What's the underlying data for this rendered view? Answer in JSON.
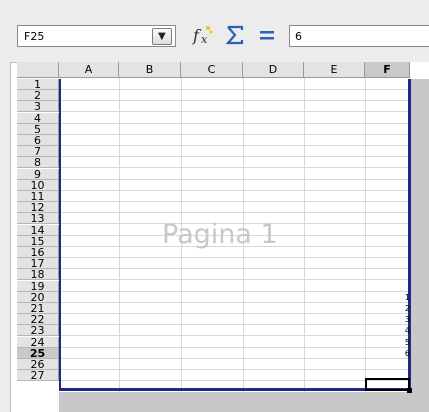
{
  "formula_bar": {
    "cell_reference": "F25",
    "cell_content": "6",
    "function_wizard_icon": "fx-icon",
    "sum_icon": "sum-icon",
    "formula_icon": "equals-icon"
  },
  "columns": [
    "A",
    "B",
    "C",
    "D",
    "E",
    "F"
  ],
  "active_column": "F",
  "rows": [
    "1",
    "2",
    "3",
    "4",
    "5",
    "6",
    "7",
    "8",
    "9",
    "10",
    "11",
    "12",
    "13",
    "14",
    "15",
    "16",
    "17",
    "18",
    "19",
    "20",
    "21",
    "22",
    "23",
    "24",
    "25",
    "26",
    "27"
  ],
  "active_row": "25",
  "watermark": "Pagina 1",
  "visible_values_column_f": [
    {
      "row": "20",
      "text": "1"
    },
    {
      "row": "21",
      "text": "2"
    },
    {
      "row": "22",
      "text": "3"
    },
    {
      "row": "23",
      "text": "4"
    },
    {
      "row": "24",
      "text": "5"
    },
    {
      "row": "25",
      "text": "6"
    }
  ],
  "colors": {
    "page_border": "#1f2a86",
    "watermark": "#c8c8c8",
    "header_bg": "#e3e3e3"
  }
}
